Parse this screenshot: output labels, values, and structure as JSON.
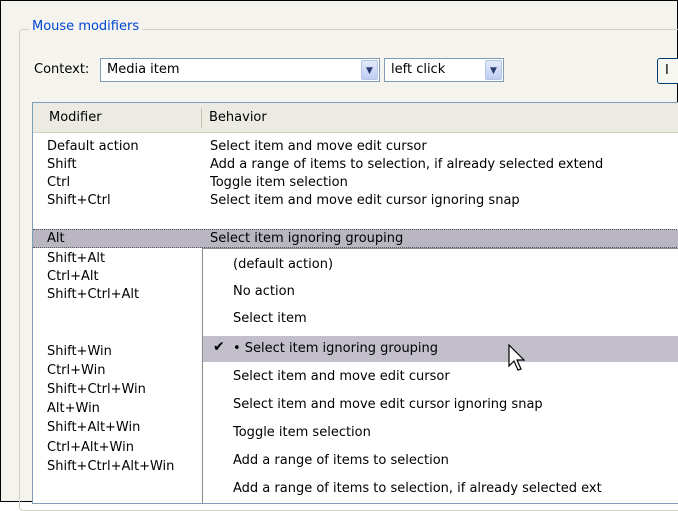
{
  "group": {
    "title": "Mouse modifiers"
  },
  "context": {
    "label": "Context:",
    "context_value": "Media item",
    "action_value": "left click",
    "edge_button_label": "I"
  },
  "table": {
    "headers": {
      "modifier": "Modifier",
      "behavior": "Behavior"
    },
    "rows": [
      {
        "modifier": "Default action",
        "behavior": "Select item and move edit cursor"
      },
      {
        "modifier": "Shift",
        "behavior": "Add a range of items to selection, if already selected extend"
      },
      {
        "modifier": "Ctrl",
        "behavior": "Toggle item selection"
      },
      {
        "modifier": "Shift+Ctrl",
        "behavior": "Select item and move edit cursor ignoring snap"
      },
      {
        "modifier": "Alt",
        "behavior": "Select item ignoring grouping"
      }
    ],
    "extra_modifiers": [
      "Shift+Alt",
      "Ctrl+Alt",
      "Shift+Ctrl+Alt",
      "Shift+Win",
      "Ctrl+Win",
      "Shift+Ctrl+Win",
      "Alt+Win",
      "Shift+Alt+Win",
      "Ctrl+Alt+Win",
      "Shift+Ctrl+Alt+Win"
    ]
  },
  "menu": {
    "items": [
      "(default action)",
      "No action",
      "Select item",
      "• Select item ignoring grouping",
      "Select item and move edit cursor",
      "Select item and move edit cursor ignoring snap",
      "Toggle item selection",
      "Add a range of items to selection",
      "Add a range of items to selection, if already selected ext"
    ],
    "checked_index": 3,
    "check_glyph": "✔"
  },
  "colors": {
    "group_title": "#0046d5",
    "selected_row": "#b9b6c2",
    "menu_highlight": "#c2bfcb"
  },
  "icons": {
    "dropdown": "chevron-down-icon",
    "cursor": "arrow-cursor-icon"
  }
}
